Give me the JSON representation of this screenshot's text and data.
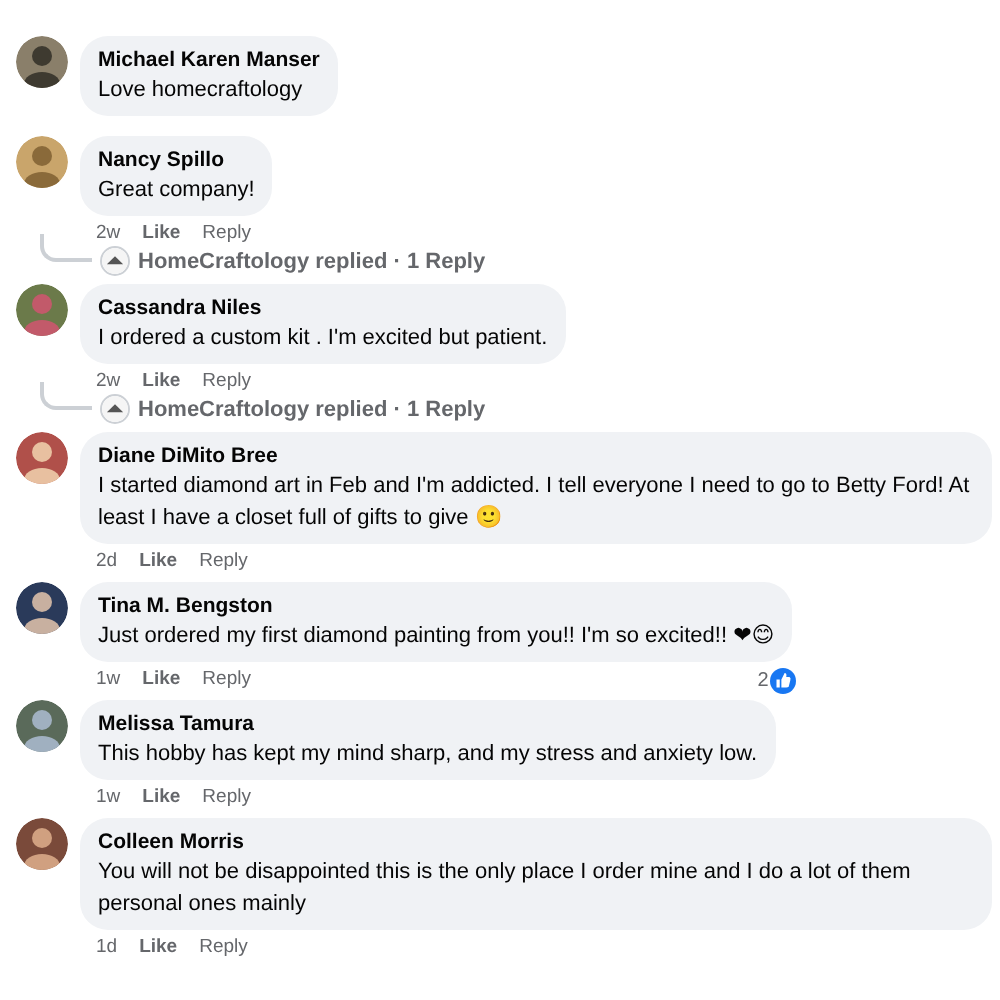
{
  "comments": [
    {
      "name": "Michael Karen Manser",
      "text": "Love homecraftology"
    },
    {
      "name": "Nancy Spillo",
      "text": "Great company!",
      "meta": {
        "time": "2w",
        "like": "Like",
        "reply": "Reply"
      },
      "replies": {
        "author": "HomeCraftology",
        "label": "replied · 1 Reply"
      }
    },
    {
      "name": "Cassandra Niles",
      "text": "I ordered a custom kit . I'm excited but patient.",
      "meta": {
        "time": "2w",
        "like": "Like",
        "reply": "Reply"
      },
      "replies": {
        "author": "HomeCraftology",
        "label": "replied · 1 Reply"
      }
    },
    {
      "name": "Diane DiMito Bree",
      "text": "I started diamond art in Feb and I'm addicted. I tell everyone I need to go to Betty Ford! At least I have a closet full of gifts to give 🙂",
      "meta": {
        "time": "2d",
        "like": "Like",
        "reply": "Reply"
      }
    },
    {
      "name": "Tina M. Bengston",
      "text": "Just ordered my first diamond painting from you!! I'm so excited!! ❤😊",
      "meta": {
        "time": "1w",
        "like": "Like",
        "reply": "Reply"
      },
      "reaction_count": "2"
    },
    {
      "name": "Melissa Tamura",
      "text": "This hobby has kept my mind sharp, and my stress and anxiety low.",
      "meta": {
        "time": "1w",
        "like": "Like",
        "reply": "Reply"
      }
    },
    {
      "name": "Colleen Morris",
      "text": "You will not be disappointed this is the only place I order mine and I do a lot of them personal ones mainly",
      "meta": {
        "time": "1d",
        "like": "Like",
        "reply": "Reply"
      }
    }
  ]
}
